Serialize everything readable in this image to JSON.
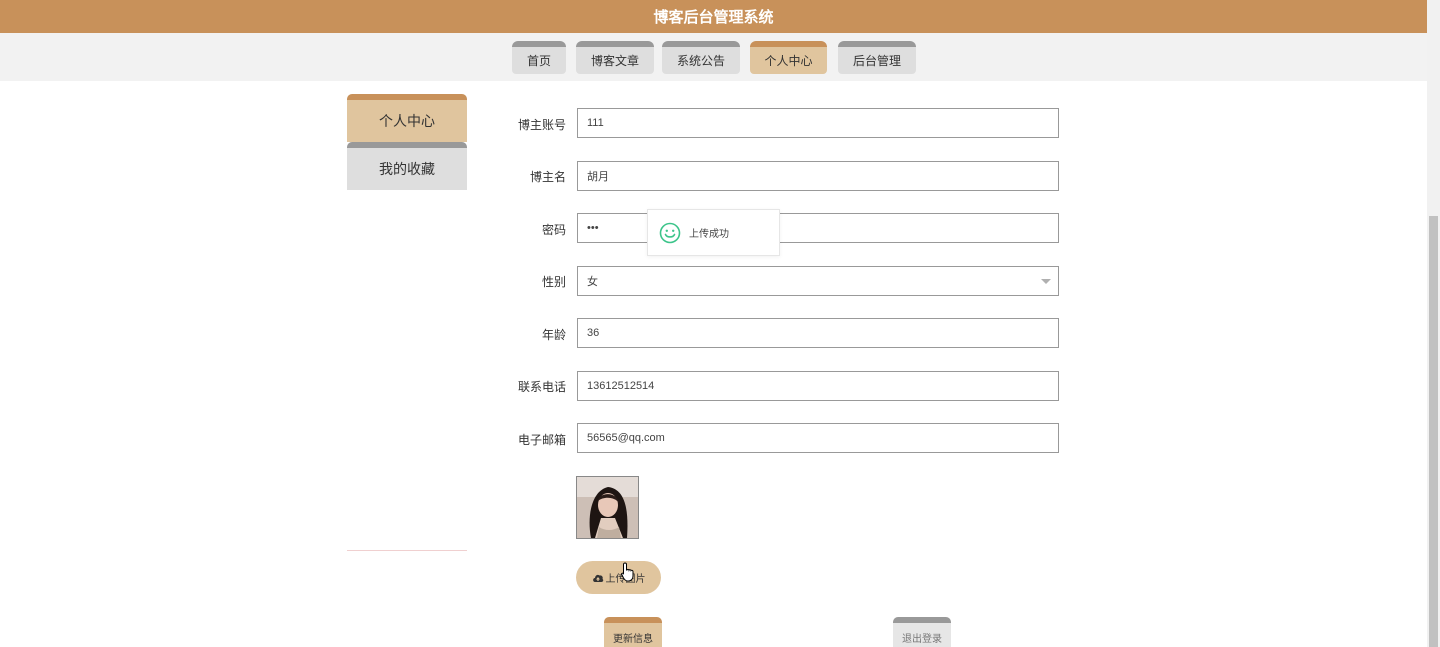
{
  "header": {
    "title": "博客后台管理系统"
  },
  "nav": {
    "tabs": [
      {
        "label": "首页"
      },
      {
        "label": "博客文章"
      },
      {
        "label": "系统公告"
      },
      {
        "label": "个人中心"
      },
      {
        "label": "后台管理"
      }
    ],
    "active_tab": "个人中心"
  },
  "sidebar": {
    "items": [
      {
        "label": "个人中心"
      },
      {
        "label": "我的收藏"
      }
    ]
  },
  "form": {
    "account": {
      "label": "博主账号",
      "value": "111"
    },
    "name": {
      "label": "博主名",
      "value": "胡月"
    },
    "password": {
      "label": "密码",
      "value": "•••"
    },
    "gender": {
      "label": "性别",
      "value": "女"
    },
    "age": {
      "label": "年龄",
      "value": "36"
    },
    "phone": {
      "label": "联系电话",
      "value": "13612512514"
    },
    "email": {
      "label": "电子邮箱",
      "value": "56565@qq.com"
    },
    "upload_button": "上传图片",
    "update_button": "更新信息",
    "logout_button": "退出登录"
  },
  "toast": {
    "message": "上传成功",
    "icon": "smile-icon"
  },
  "colors": {
    "brand": "#c8915a",
    "active_tab": "#e0c59e",
    "inactive_tab": "#dedede",
    "tab_top_border": "#999999",
    "toast_icon": "#3cc48a"
  }
}
